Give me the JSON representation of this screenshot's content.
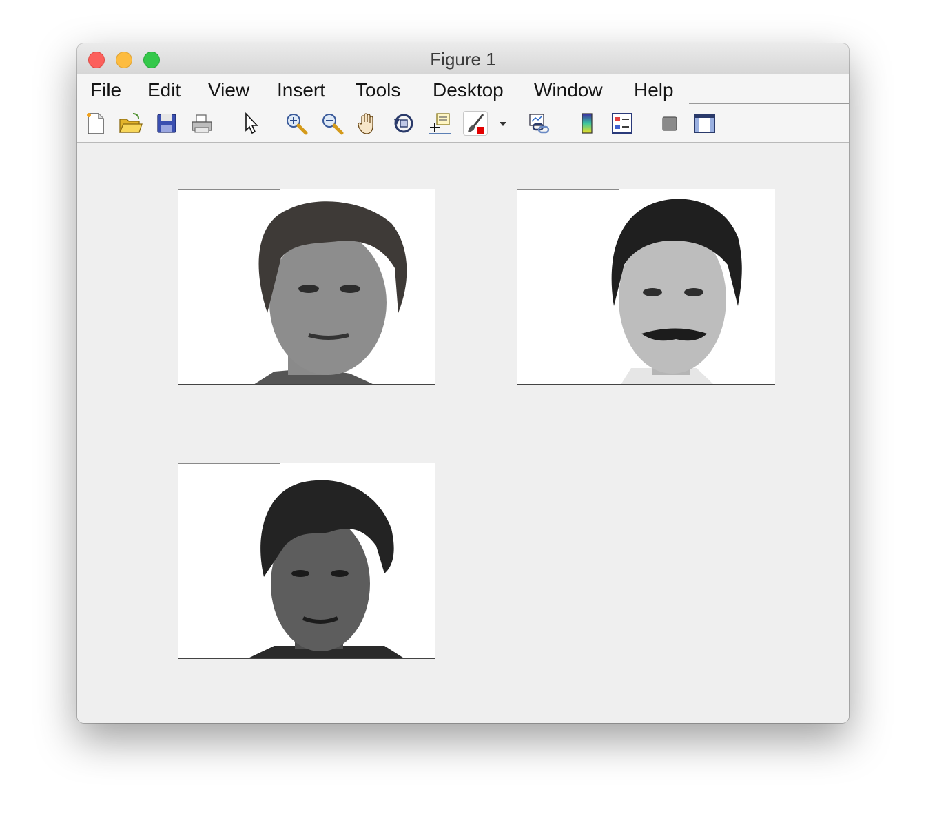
{
  "window": {
    "title": "Figure 1"
  },
  "menu": [
    {
      "label": "File"
    },
    {
      "label": "Edit"
    },
    {
      "label": "View"
    },
    {
      "label": "Insert"
    },
    {
      "label": "Tools"
    },
    {
      "label": "Desktop"
    },
    {
      "label": "Window"
    },
    {
      "label": "Help"
    }
  ],
  "toolbar": [
    {
      "icon": "new-figure-icon"
    },
    {
      "icon": "open-file-icon"
    },
    {
      "icon": "save-icon"
    },
    {
      "icon": "print-icon"
    },
    {
      "icon": "edit-plot-pointer-icon"
    },
    {
      "icon": "zoom-in-icon"
    },
    {
      "icon": "zoom-out-icon"
    },
    {
      "icon": "pan-hand-icon"
    },
    {
      "icon": "rotate-3d-icon"
    },
    {
      "icon": "data-cursor-icon"
    },
    {
      "icon": "brush-icon"
    },
    {
      "icon": "link-plot-icon"
    },
    {
      "icon": "colorbar-icon"
    },
    {
      "icon": "legend-icon"
    },
    {
      "icon": "hide-plot-tools-icon"
    },
    {
      "icon": "show-plot-tools-icon"
    }
  ],
  "subplots": [
    {
      "image": "face-portrait-light-hair",
      "hair": "#3e3a37",
      "skin": "#8d8d8d"
    },
    {
      "image": "face-portrait-mustache",
      "hair": "#1f1f1f",
      "skin": "#bdbdbd"
    },
    {
      "image": "face-portrait-dark-hair",
      "hair": "#232323",
      "skin": "#5d5d5d"
    }
  ]
}
